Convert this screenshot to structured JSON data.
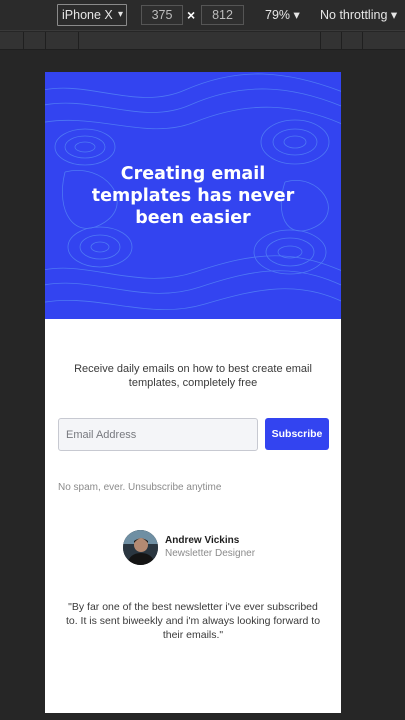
{
  "devtools": {
    "device": "iPhone X",
    "width": "375",
    "times": "×",
    "height": "812",
    "zoom": "79%",
    "throttle": "No throttling",
    "caret": "▾"
  },
  "page": {
    "hero_title": "Creating email templates has never been easier",
    "lede": "Receive daily emails on how to best create email templates, completely free",
    "email_placeholder": "Email Address",
    "subscribe_label": "Subscribe",
    "fine_print": "No spam, ever. Unsubscribe anytime",
    "author_name": "Andrew Vickins",
    "author_role": "Newsletter Designer",
    "quote": "\"By far one of the best newsletter i've ever subscribed to. It is sent biweekly and i'm always looking forward to their emails.\"",
    "accent_color": "#3344f0"
  }
}
